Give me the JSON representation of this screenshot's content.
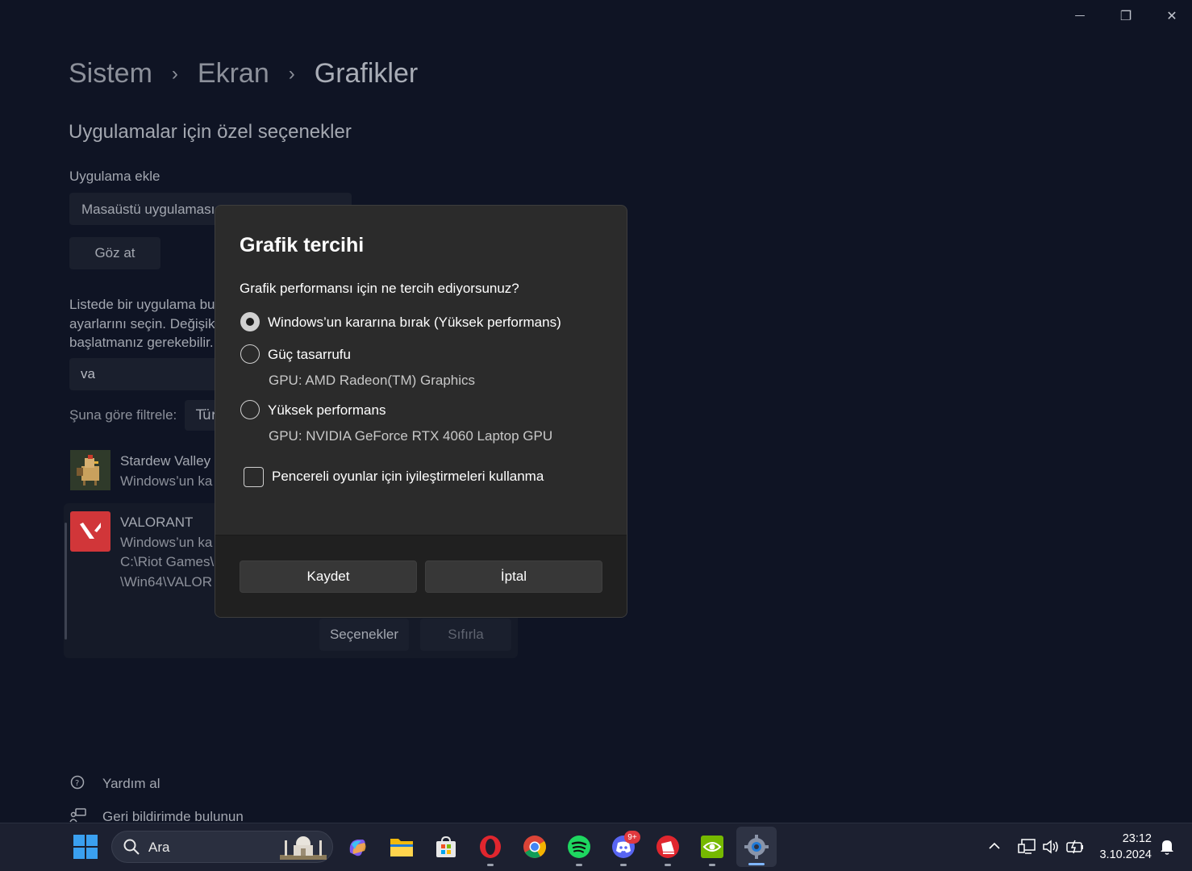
{
  "window": {
    "minimize_glyph": "—",
    "restore_glyph": "❐",
    "close_glyph": "✕"
  },
  "breadcrumb": {
    "items": [
      "Sistem",
      "Ekran",
      "Grafikler"
    ],
    "separator": "›"
  },
  "section_title": "Uygulamalar için özel seçenekler",
  "add_app": {
    "label": "Uygulama ekle",
    "select_value": "Masaüstü uygulaması",
    "browse_label": "Göz at"
  },
  "description_lines": [
    "Listede bir uygulama bu",
    "ayarlarını seçin. Değişik",
    "başlatmanız gerekebilir."
  ],
  "search_value": "va",
  "filter": {
    "label": "Şuna göre filtrele:",
    "value": "Tür"
  },
  "apps": [
    {
      "name": "Stardew Valley",
      "status": "Windows’un ka"
    },
    {
      "name": "VALORANT",
      "status": "Windows’un ka",
      "path1": "C:\\Riot Games\\",
      "path2": "\\Win64\\VALOR"
    }
  ],
  "app_actions": {
    "options_label": "Seçenekler",
    "reset_label": "Sıfırla"
  },
  "dialog": {
    "title": "Grafik tercihi",
    "question": "Grafik performansı için ne tercih ediyorsunuz?",
    "options": [
      {
        "label": "Windows’un kararına bırak (Yüksek performans)",
        "selected": true
      },
      {
        "label": "Güç tasarrufu",
        "detail": "GPU: AMD Radeon(TM) Graphics",
        "selected": false
      },
      {
        "label": "Yüksek performans",
        "detail": "GPU: NVIDIA GeForce RTX 4060 Laptop GPU",
        "selected": false
      }
    ],
    "checkbox_label": "Pencereli oyunlar için iyileştirmeleri kullanma",
    "save_label": "Kaydet",
    "cancel_label": "İptal"
  },
  "links": {
    "help": "Yardım al",
    "feedback": "Geri bildirimde bulunun"
  },
  "taskbar": {
    "search_placeholder": "Ara",
    "discord_badge": "9+",
    "time": "23:12",
    "date": "3.10.2024",
    "accent": "#0078d4"
  }
}
